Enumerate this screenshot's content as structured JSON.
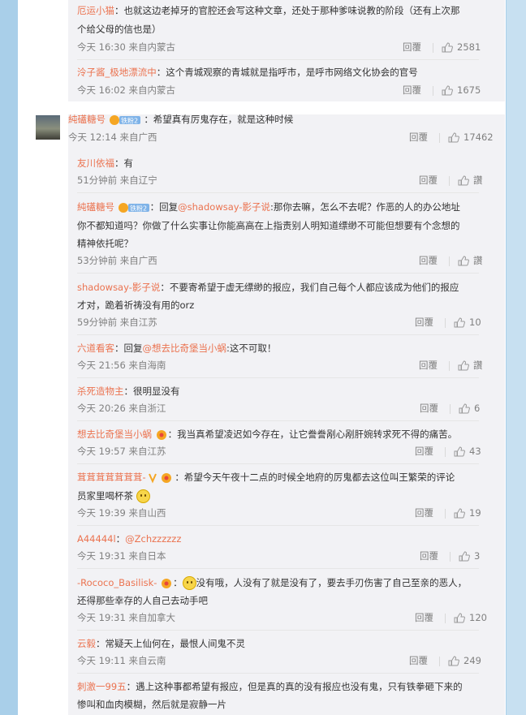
{
  "actions": {
    "reply_label": "回覆",
    "like_placeholder": "讚"
  },
  "colors": {
    "username": "#eb7350",
    "background": "#a9cfe9",
    "subpanel": "#f2f2f5"
  },
  "top_comments": [
    {
      "user": "厄运小猫",
      "text": "：也就这边老掉牙的官腔还会写这种文章，还处于那种爹味说教的阶段（还有上次那",
      "text2": "个给父母的信也是）",
      "time": "今天 16:30 来自内蒙古",
      "likes": "2581"
    },
    {
      "user": "泠子酱_极地漂流中",
      "text": "：这个青城观察的青城就是指呼市，是呼市网络文化协会的官号",
      "time": "今天 16:02 来自内蒙古",
      "likes": "1675"
    }
  ],
  "main_comment": {
    "user": "純礚糖号",
    "badge": "铁粉2",
    "text": "：希望真有厉鬼存在，就是这种时候",
    "time": "今天 12:14 来自广西",
    "likes": "17462"
  },
  "replies": [
    {
      "user": "友川依福",
      "text": "：有",
      "time": "51分钟前 来自辽宁",
      "likes": "讚"
    },
    {
      "user": "純礚糖号",
      "badge": "铁粉2",
      "text_pre": "：回复",
      "mention": "@shadowsay-影子说",
      "text": ":那你去嘛，怎么不去呢？作恶的人的办公地址",
      "text2": "你不都知道吗？你做了什么实事让你能高高在上指责别人明知道缥缈不可能但想要有个念想的",
      "text3": "精神依托呢？",
      "time": "53分钟前 来自广西",
      "likes": "讚"
    },
    {
      "user": "shadowsay-影子说",
      "text": "：不要寄希望于虚无缥缈的报应，我们自己每个人都应该成为他们的报应",
      "text2": "才对，跪着祈祷没有用的orz",
      "time": "59分钟前 来自江苏",
      "likes": "10"
    },
    {
      "user": "六道看客",
      "text_pre": "：回复",
      "mention": "@想去比奇堡当小蜗",
      "text": ":这不可取！",
      "time": "今天 21:56 来自海南",
      "likes": "讚"
    },
    {
      "user": "杀死造物主",
      "text": "：很明显没有",
      "time": "今天 20:26 来自浙江",
      "likes": "6"
    },
    {
      "user": "想去比奇堡当小蜗",
      "text": "：我当真希望凌迟如今存在，让它誊誊剐心剐肝婉转求死不得的痛苦。",
      "time": "今天 19:57 来自江苏",
      "likes": "43"
    },
    {
      "user": "茸茸茸茸茸茸茸-",
      "text": "：希望今天午夜十二点的时候全地府的厉鬼都去这位叫王繁荣的评论",
      "text2": "员家里喝杯茶",
      "time": "今天 19:39 来自山西",
      "likes": "19"
    },
    {
      "user": "A44444l",
      "text_pre": "：",
      "mention": "@Zchzzzzzz",
      "text": "",
      "time": "今天 19:31 来自日本",
      "likes": "3"
    },
    {
      "user": "-Rococo_Basilisk-",
      "text": "没有哦，人没有了就是没有了，要去手刃伤害了自己至亲的恶人，",
      "text2": "还得那些幸存的人自己去动手吧",
      "time": "今天 19:31 来自加拿大",
      "likes": "120"
    },
    {
      "user": "云毅",
      "text": "：常疑天上仙何在，最恨人间鬼不灵",
      "time": "今天 19:11 来自云南",
      "likes": "249"
    },
    {
      "user": "刺激一99五",
      "text": "：遇上这种事都希望有报应，但是真的真的没有报应也没有鬼，只有铁拳砸下来的",
      "text2": "惨叫和血肉模糊，然后就是寂静一片"
    }
  ]
}
